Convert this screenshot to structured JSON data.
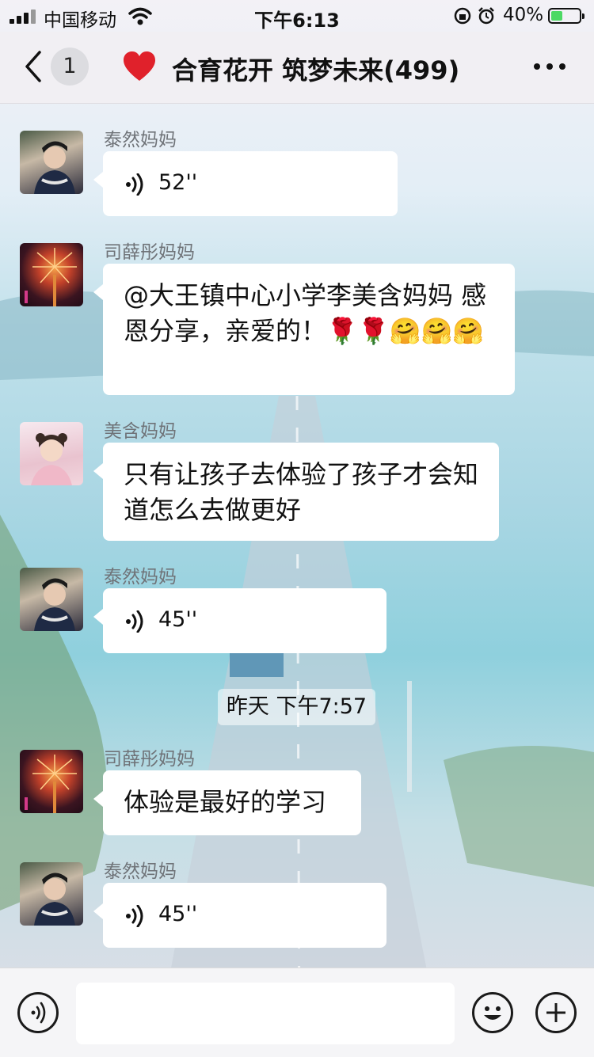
{
  "status_bar": {
    "carrier": "中国移动",
    "time": "下午6:13",
    "battery_percent": "40%",
    "battery_level": 0.4,
    "icons": [
      "signal-icon",
      "wifi-icon",
      "orientation-lock-icon",
      "alarm-icon",
      "battery-charging-icon"
    ]
  },
  "nav": {
    "unread_count": "1",
    "title": "合育花开 筑梦未来(499)",
    "icons": [
      "back-chevron-icon",
      "heart-icon",
      "more-icon"
    ]
  },
  "messages": [
    {
      "sender": "泰然妈妈",
      "type": "voice",
      "duration": "52''"
    },
    {
      "sender": "司薛彤妈妈",
      "type": "text",
      "text": "@大王镇中心小学李美含妈妈 感恩分享，亲爱的！🌹🌹🤗🤗🤗"
    },
    {
      "sender": "美含妈妈",
      "type": "text",
      "text": "只有让孩子去体验了孩子才会知道怎么去做更好"
    },
    {
      "sender": "泰然妈妈",
      "type": "voice",
      "duration": "45''"
    },
    {
      "sender": "司薛彤妈妈",
      "type": "text",
      "text": "体验是最好的学习"
    },
    {
      "sender": "泰然妈妈",
      "type": "voice",
      "duration": "45''"
    }
  ],
  "timestamp": "昨天 下午7:57",
  "input_bar": {
    "placeholder": "",
    "icons": [
      "voice-input-icon",
      "emoji-icon",
      "add-icon"
    ]
  },
  "colors": {
    "bubble": "#ffffff",
    "nav_background": "#f0eef3",
    "battery_fill": "#4cd964",
    "heart": "#e0212b"
  }
}
